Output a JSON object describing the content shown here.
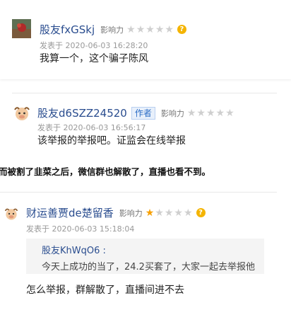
{
  "comments": [
    {
      "username": "股友fxGSkj",
      "influence_label": "影响力",
      "stars": {
        "filled": 0,
        "total": 5
      },
      "help_icon": "?",
      "time": "发表于 2020-06-03 16:28:20",
      "text": "我算一个，这个骗子陈风"
    },
    {
      "username": "股友d6SZZ24520",
      "author_tag": "作者",
      "influence_label": "影响力",
      "stars": {
        "filled": 0,
        "total": 5
      },
      "time": "发表于 2020-06-03 16:56:17",
      "text": "该举报的举报吧。证监会在线举报"
    },
    {
      "username": "财运善贾de楚留香",
      "influence_label": "影响力",
      "stars": {
        "filled": 1,
        "total": 5
      },
      "help_icon": "?",
      "time": "发表于 2020-06-03 15:18:04",
      "quote": {
        "username": "股友KhWqO6 :",
        "text": "今天上成功的当了，24.2买套了，大家一起去举报他"
      },
      "text": "怎么举报，群解散了，直播间进不去"
    }
  ],
  "overlay_text": "而被割了韭菜之后，微信群也解散了，直播也看不到。",
  "colors": {
    "star_on": "#f7a000",
    "star_off": "#cfcfcf",
    "link": "#2a4d8f",
    "help": "#f4b400"
  }
}
